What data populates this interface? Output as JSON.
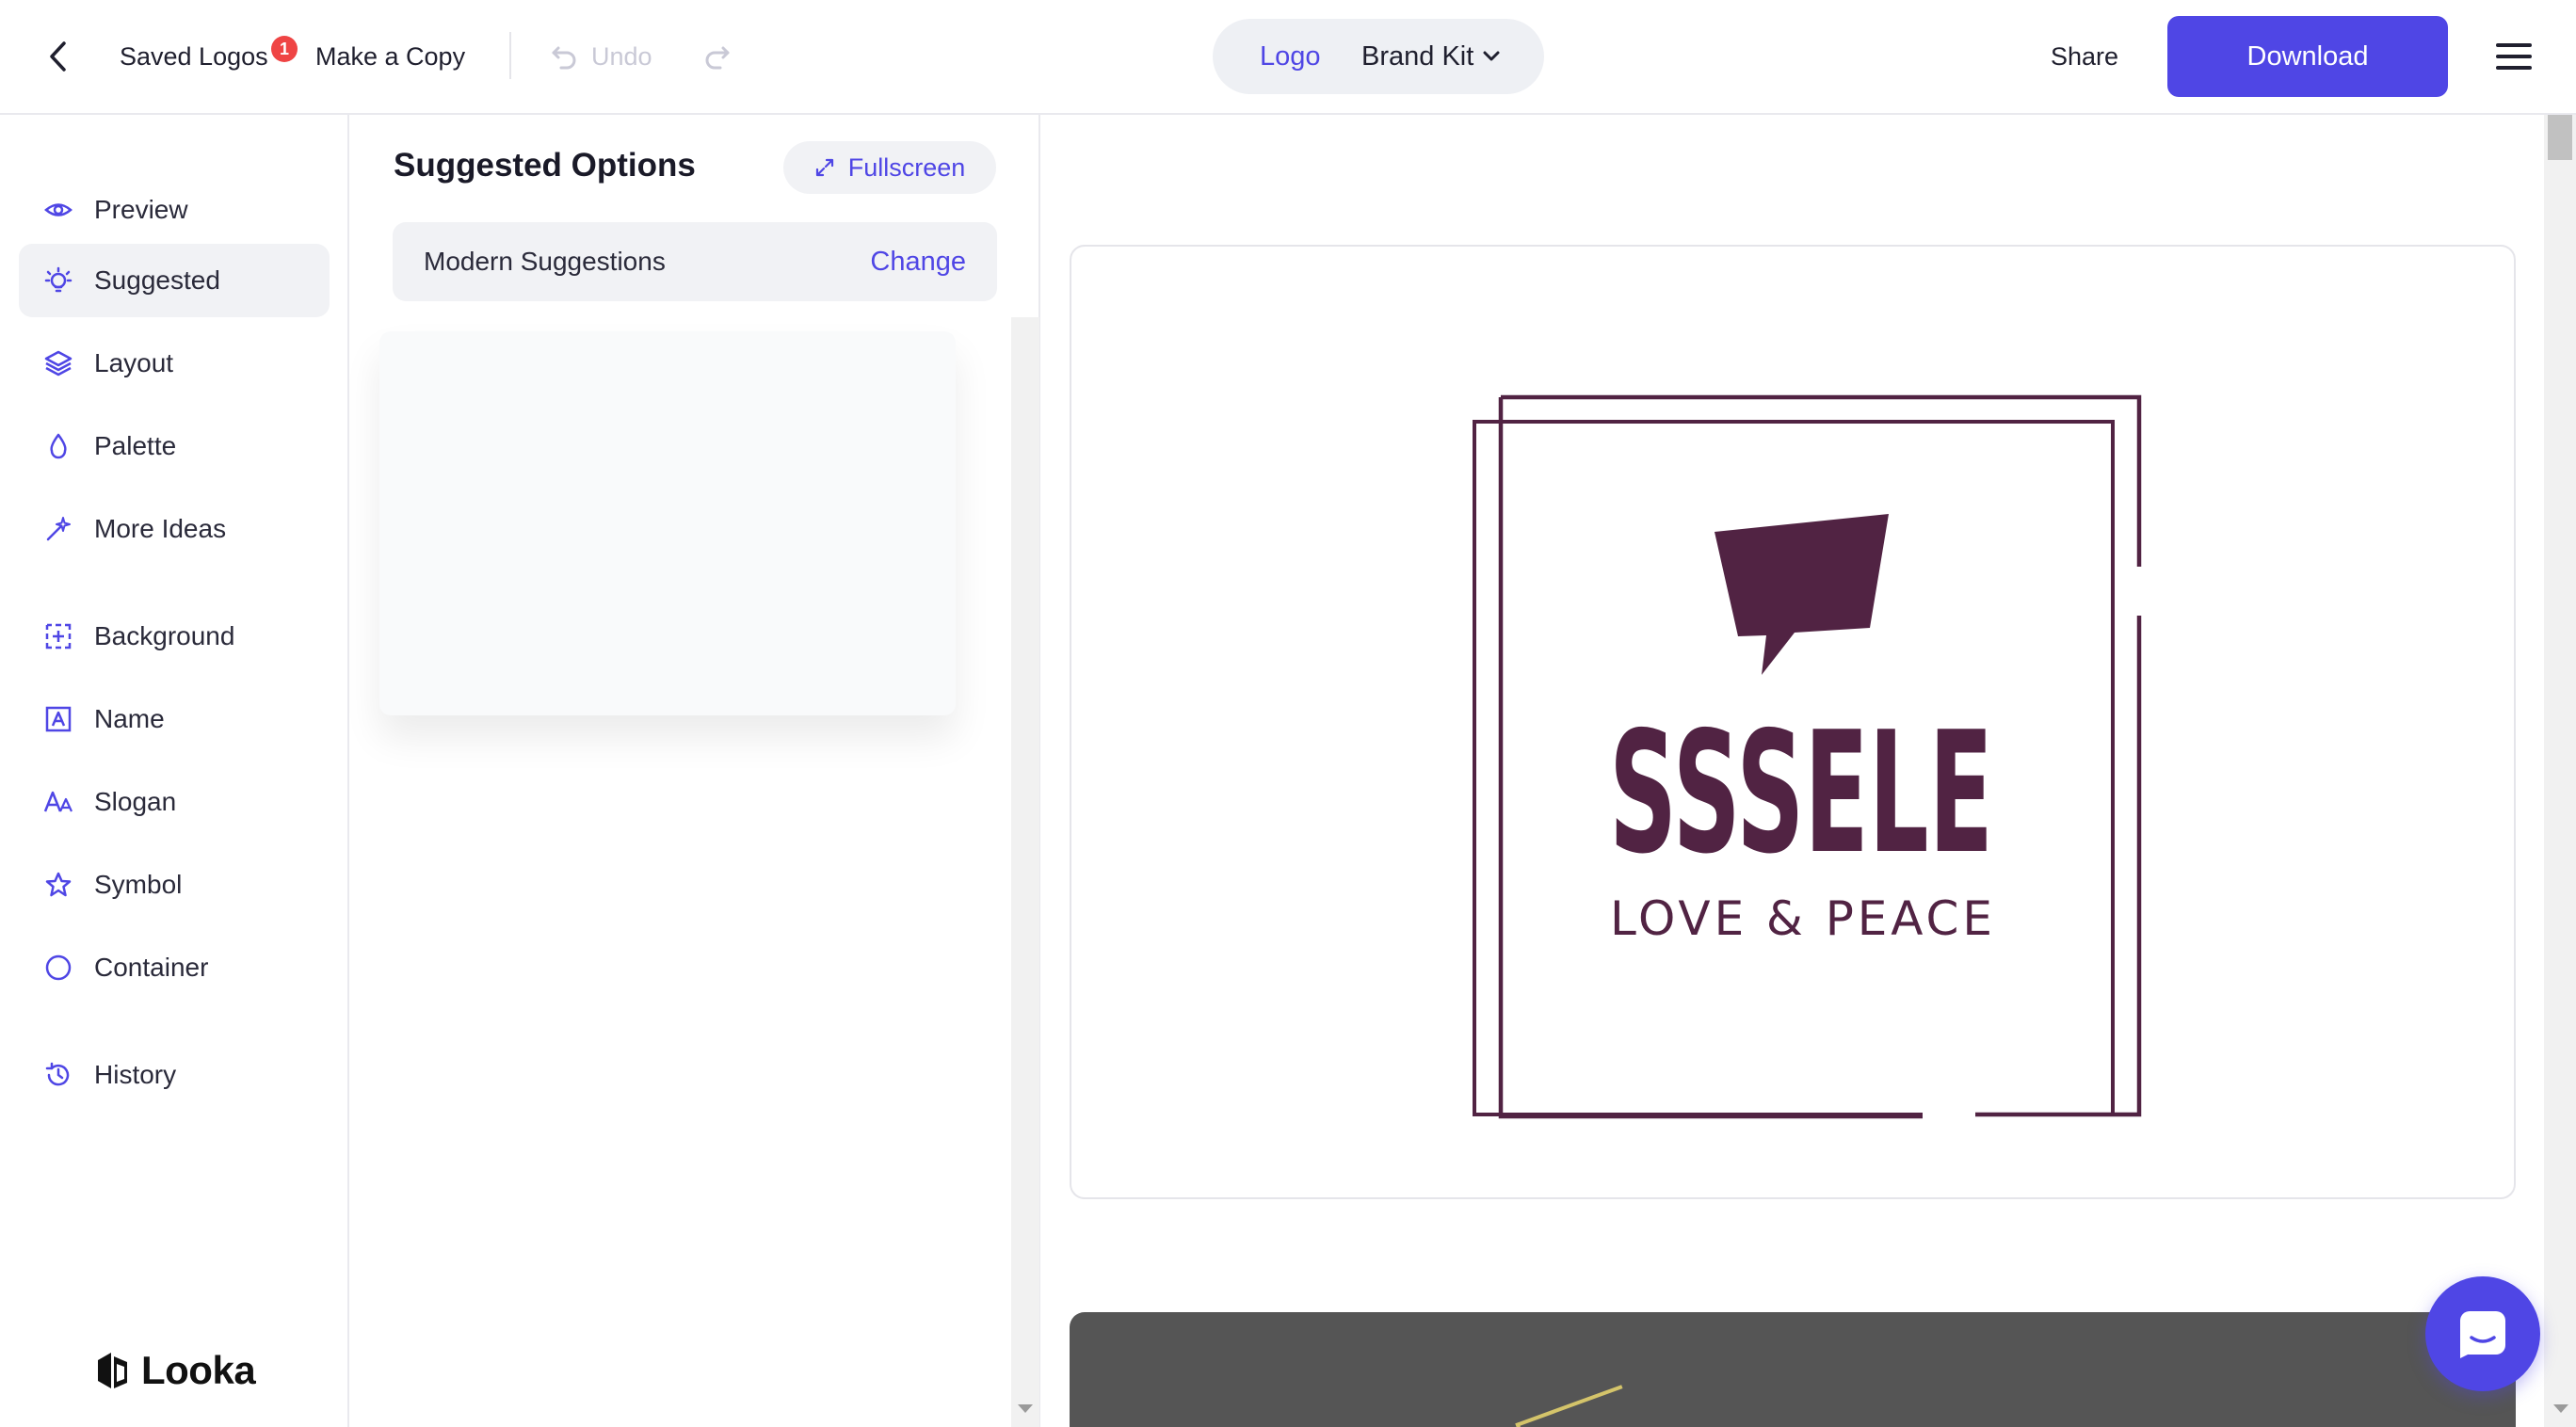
{
  "topbar": {
    "saved_logos": "Saved Logos",
    "saved_logos_badge": "1",
    "make_copy": "Make a Copy",
    "undo": "Undo",
    "mode_logo": "Logo",
    "mode_brand_kit": "Brand Kit",
    "share": "Share",
    "download": "Download"
  },
  "sidebar": {
    "items": [
      {
        "label": "Preview",
        "icon": "eye-icon"
      },
      {
        "label": "Suggested",
        "icon": "lightbulb-icon",
        "active": true
      },
      {
        "label": "Layout",
        "icon": "layers-icon"
      },
      {
        "label": "Palette",
        "icon": "droplet-icon"
      },
      {
        "label": "More Ideas",
        "icon": "magic-wand-icon"
      },
      {
        "label": "Background",
        "icon": "background-grid-icon"
      },
      {
        "label": "Name",
        "icon": "text-box-icon"
      },
      {
        "label": "Slogan",
        "icon": "font-size-icon"
      },
      {
        "label": "Symbol",
        "icon": "star-icon"
      },
      {
        "label": "Container",
        "icon": "circle-icon"
      },
      {
        "label": "History",
        "icon": "history-icon"
      }
    ],
    "brand": "Looka"
  },
  "panel": {
    "title": "Suggested Options",
    "fullscreen": "Fullscreen",
    "suggestion_label": "Modern Suggestions",
    "change": "Change"
  },
  "logo": {
    "name": "SSSELE",
    "slogan": "LOVE & PEACE",
    "color": "#512343"
  },
  "colors": {
    "accent": "#4f46e5",
    "badge": "#ef4444"
  }
}
